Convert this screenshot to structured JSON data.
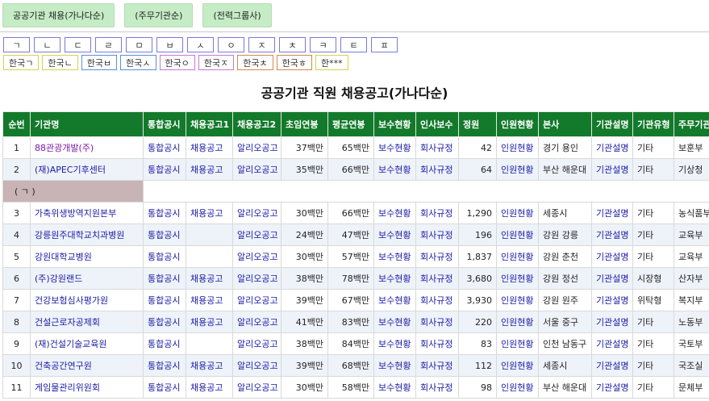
{
  "top_tabs": [
    "공공기관 채용(가나다순)",
    "(주무기관순)",
    "(전력그룹사)"
  ],
  "letters": [
    "ㄱ",
    "ㄴ",
    "ㄷ",
    "ㄹ",
    "ㅁ",
    "ㅂ",
    "ㅅ",
    "ㅇ",
    "ㅈ",
    "ㅊ",
    "ㅋ",
    "ㅌ",
    "ㅍ"
  ],
  "hangul_buttons": [
    "한국ㄱ",
    "한국ㄴ",
    "한국ㅂ",
    "한국ㅅ",
    "한국ㅇ",
    "한국ㅈ",
    "한국ㅊ",
    "한국ㅎ",
    "한***"
  ],
  "page_title": "공공기관 직원 채용공고(가나다순)",
  "table": {
    "headers": [
      "순번",
      "기관명",
      "통합공시",
      "채용공고1",
      "채용공고2",
      "초임연봉",
      "평균연봉",
      "보수현황",
      "인사보수",
      "정원",
      "인원현황",
      "본사",
      "기관설명",
      "기관유형",
      "주무기관"
    ],
    "rows_top": [
      {
        "no": "1",
        "org": "88관광개발(주)",
        "disclosure": "통합공시",
        "recruit1": "채용공고",
        "recruit2": "알리오공고",
        "start_salary": "37백만",
        "avg_salary": "65백만",
        "pay": "보수현황",
        "hr": "회사규정",
        "capacity": "42",
        "staff": "인원현황",
        "hq": "경기 용인",
        "desc": "기관설명",
        "type": "기타",
        "ministry": "보훈부"
      },
      {
        "no": "2",
        "org": "(재)APEC기후센터",
        "disclosure": "통합공시",
        "recruit1": "채용공고",
        "recruit2": "알리오공고",
        "start_salary": "35백만",
        "avg_salary": "66백만",
        "pay": "보수현황",
        "hr": "회사규정",
        "capacity": "64",
        "staff": "인원현황",
        "hq": "부산 해운대",
        "desc": "기관설명",
        "type": "기타",
        "ministry": "기상청"
      }
    ],
    "group_label": "( ㄱ )",
    "rows": [
      {
        "no": "3",
        "org": "가축위생방역지원본부",
        "disclosure": "통합공시",
        "recruit1": "채용공고",
        "recruit2": "알리오공고",
        "start_salary": "30백만",
        "avg_salary": "66백만",
        "pay": "보수현황",
        "hr": "회사규정",
        "capacity": "1,290",
        "staff": "인원현황",
        "hq": "세종시",
        "desc": "기관설명",
        "type": "기타",
        "ministry": "농식품부"
      },
      {
        "no": "4",
        "org": "강릉원주대학교치과병원",
        "disclosure": "통합공시",
        "recruit1": "",
        "recruit2": "알리오공고",
        "start_salary": "24백만",
        "avg_salary": "47백만",
        "pay": "보수현황",
        "hr": "회사규정",
        "capacity": "196",
        "staff": "인원현황",
        "hq": "강원 강릉",
        "desc": "기관설명",
        "type": "기타",
        "ministry": "교육부"
      },
      {
        "no": "5",
        "org": "강원대학교병원",
        "disclosure": "통합공시",
        "recruit1": "",
        "recruit2": "알리오공고",
        "start_salary": "30백만",
        "avg_salary": "57백만",
        "pay": "보수현황",
        "hr": "회사규정",
        "capacity": "1,837",
        "staff": "인원현황",
        "hq": "강원 춘천",
        "desc": "기관설명",
        "type": "기타",
        "ministry": "교육부"
      },
      {
        "no": "6",
        "org": "(주)강원랜드",
        "disclosure": "통합공시",
        "recruit1": "채용공고",
        "recruit2": "알리오공고",
        "start_salary": "38백만",
        "avg_salary": "78백만",
        "pay": "보수현황",
        "hr": "회사규정",
        "capacity": "3,680",
        "staff": "인원현황",
        "hq": "강원 정선",
        "desc": "기관설명",
        "type": "시장형",
        "ministry": "산자부"
      },
      {
        "no": "7",
        "org": "건강보험심사평가원",
        "disclosure": "통합공시",
        "recruit1": "채용공고",
        "recruit2": "알리오공고",
        "start_salary": "39백만",
        "avg_salary": "67백만",
        "pay": "보수현황",
        "hr": "회사규정",
        "capacity": "3,930",
        "staff": "인원현황",
        "hq": "강원 원주",
        "desc": "기관설명",
        "type": "위탁형",
        "ministry": "복지부"
      },
      {
        "no": "8",
        "org": "건설근로자공제회",
        "disclosure": "통합공시",
        "recruit1": "채용공고",
        "recruit2": "알리오공고",
        "start_salary": "41백만",
        "avg_salary": "83백만",
        "pay": "보수현황",
        "hr": "회사규정",
        "capacity": "220",
        "staff": "인원현황",
        "hq": "서울 중구",
        "desc": "기관설명",
        "type": "기타",
        "ministry": "노동부"
      },
      {
        "no": "9",
        "org": "(재)건설기술교육원",
        "disclosure": "통합공시",
        "recruit1": "",
        "recruit2": "알리오공고",
        "start_salary": "38백만",
        "avg_salary": "84백만",
        "pay": "보수현황",
        "hr": "회사규정",
        "capacity": "83",
        "staff": "인원현황",
        "hq": "인천 남동구",
        "desc": "기관설명",
        "type": "기타",
        "ministry": "국토부"
      },
      {
        "no": "10",
        "org": "건축공간연구원",
        "disclosure": "통합공시",
        "recruit1": "채용공고",
        "recruit2": "알리오공고",
        "start_salary": "39백만",
        "avg_salary": "68백만",
        "pay": "보수현황",
        "hr": "회사규정",
        "capacity": "112",
        "staff": "인원현황",
        "hq": "세종시",
        "desc": "기관설명",
        "type": "기타",
        "ministry": "국조실"
      },
      {
        "no": "11",
        "org": "게임물관리위원회",
        "disclosure": "통합공시",
        "recruit1": "채용공고",
        "recruit2": "알리오공고",
        "start_salary": "30백만",
        "avg_salary": "58백만",
        "pay": "보수현황",
        "hr": "회사규정",
        "capacity": "98",
        "staff": "인원현황",
        "hq": "부산 해운대",
        "desc": "기관설명",
        "type": "기타",
        "ministry": "문체부"
      }
    ]
  }
}
